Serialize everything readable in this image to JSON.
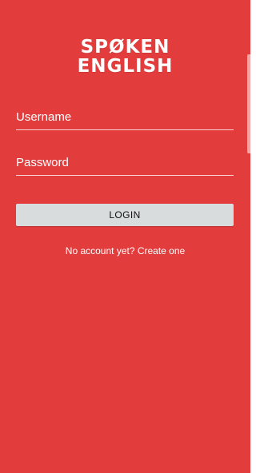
{
  "app": {
    "brand_line_1": "SPØKEN",
    "brand_line_2": "ENGLISH"
  },
  "form": {
    "username": {
      "placeholder": "Username",
      "value": ""
    },
    "password": {
      "placeholder": "Password",
      "value": ""
    },
    "login_label": "LOGIN",
    "create_account_label": "No account yet? Create one"
  },
  "colors": {
    "background": "#e23c3d",
    "button_background": "#d8dcdc",
    "text": "#ffffff"
  }
}
